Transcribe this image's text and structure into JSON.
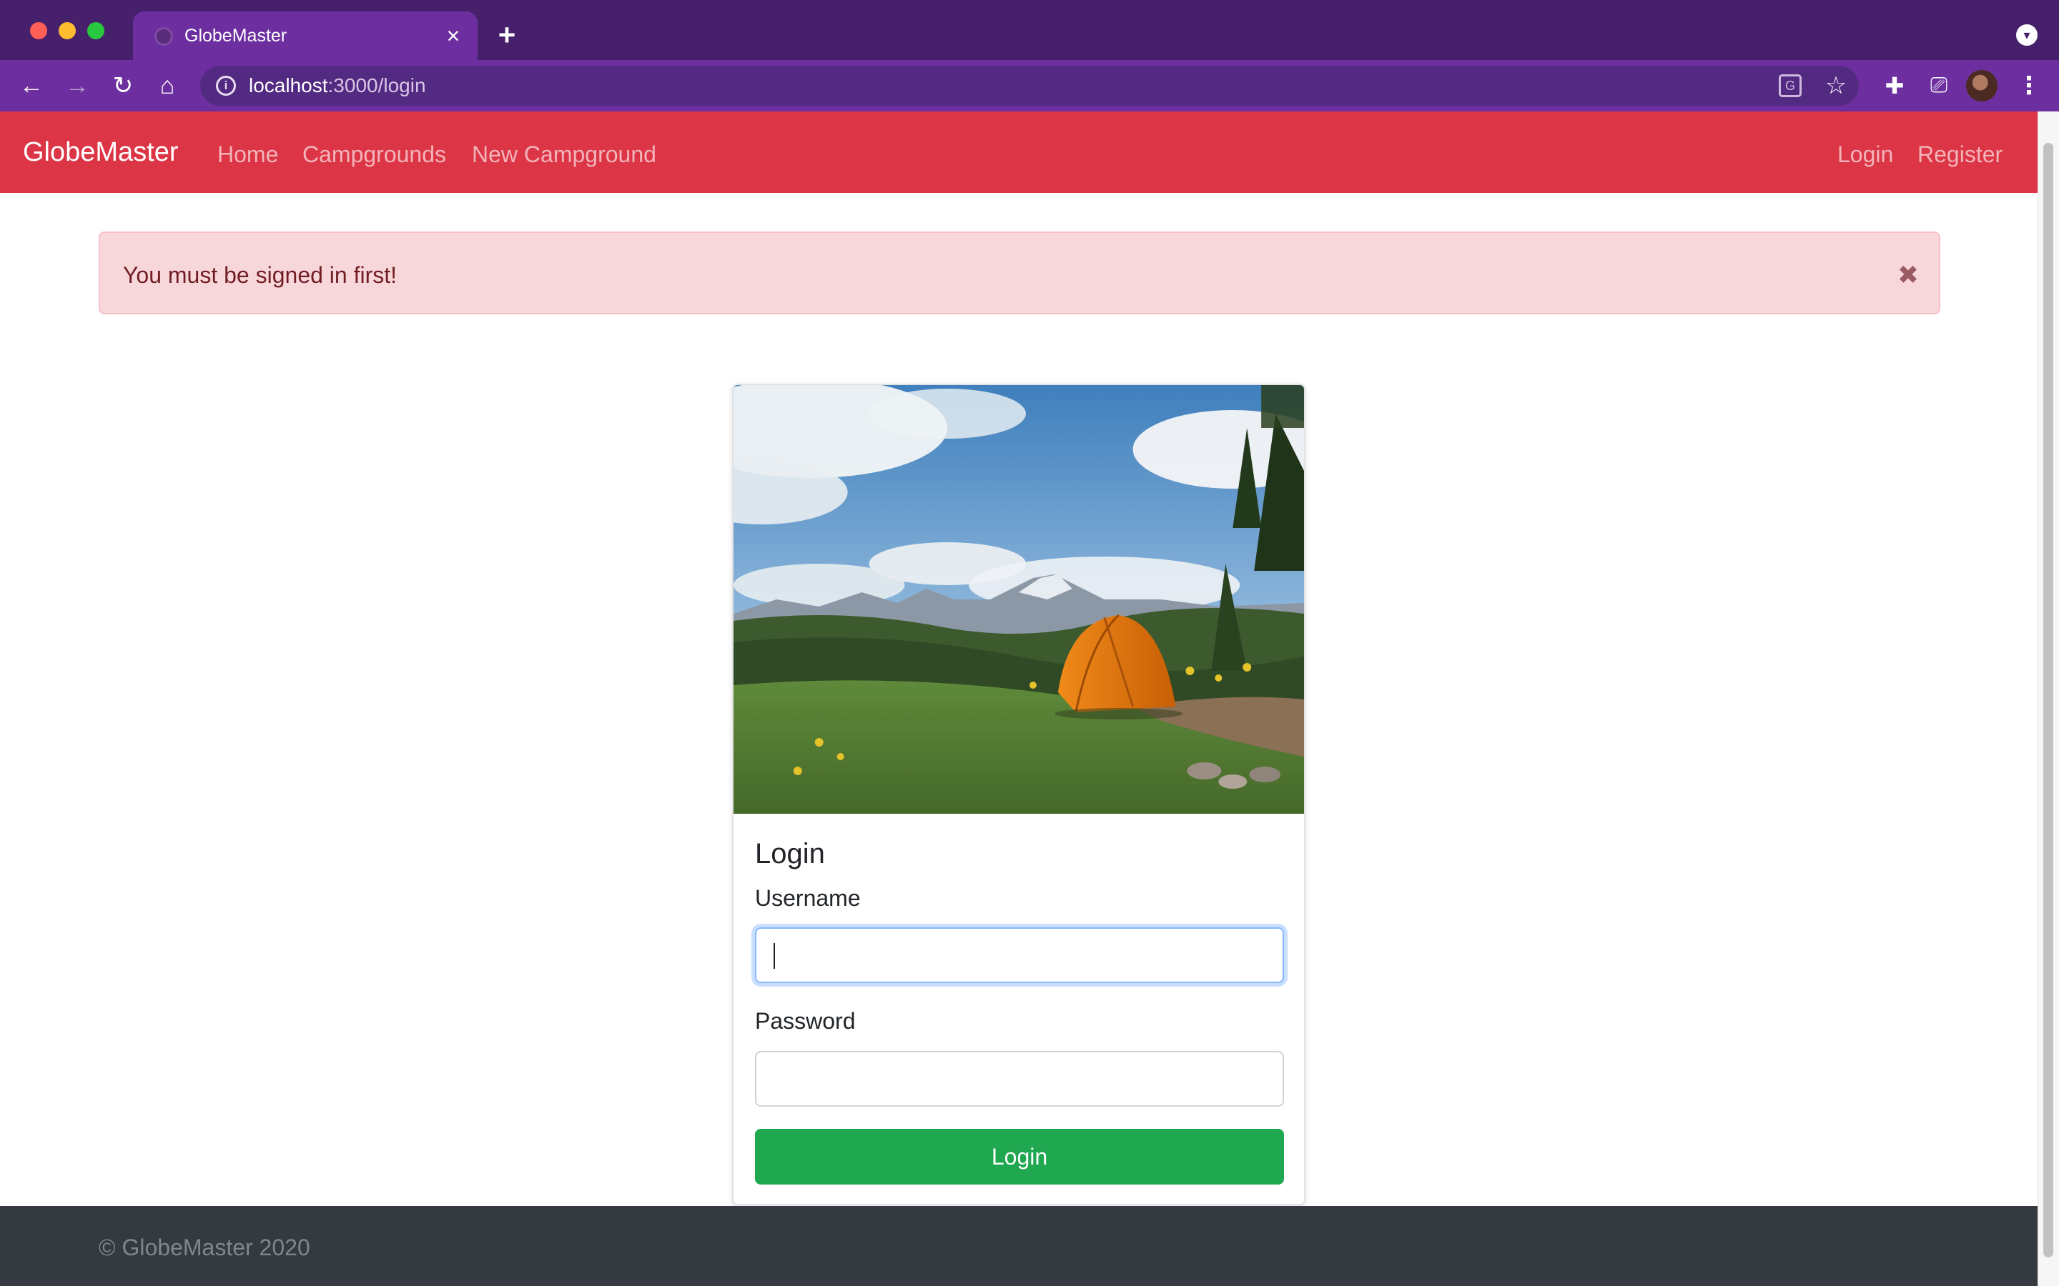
{
  "browser": {
    "tab_title": "GlobeMaster",
    "url_host": "localhost",
    "url_path": ":3000/login",
    "colors": {
      "tabbar": "#46206a",
      "toolbar": "#6d2f9f"
    }
  },
  "navbar": {
    "brand": "GlobeMaster",
    "links": [
      "Home",
      "Campgrounds",
      "New Campground"
    ],
    "right_links": [
      "Login",
      "Register"
    ],
    "color": "#dc3545"
  },
  "alert": {
    "message": "You must be signed in first!",
    "close_symbol": "✖",
    "color": "#f8d7da"
  },
  "card": {
    "image_description": "camping-tent-mountain-landscape",
    "title": "Login",
    "username_label": "Username",
    "username_value": "",
    "password_label": "Password",
    "password_value": "",
    "submit_label": "Login",
    "button_color": "#1fa84f"
  },
  "footer": {
    "text": "© GlobeMaster 2020"
  }
}
